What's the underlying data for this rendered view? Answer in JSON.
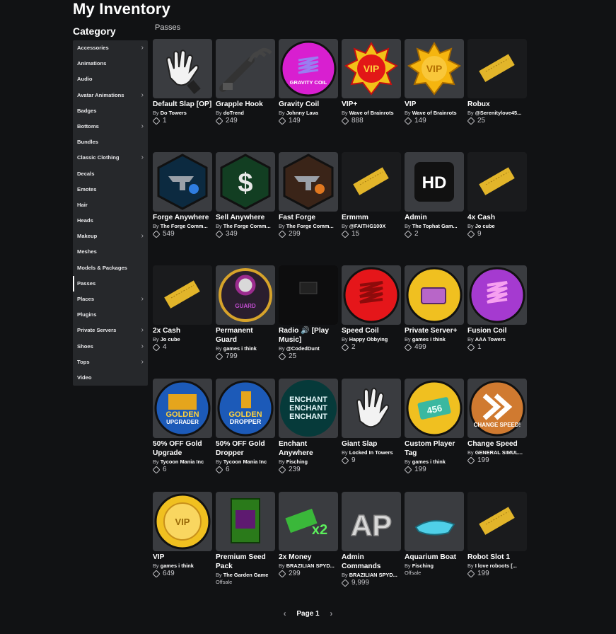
{
  "page_title": "My Inventory",
  "category_title": "Category",
  "section_label": "Passes",
  "categories": [
    {
      "label": "Accessories",
      "chevron": true
    },
    {
      "label": "Animations",
      "chevron": false
    },
    {
      "label": "Audio",
      "chevron": false
    },
    {
      "label": "Avatar Animations",
      "chevron": true
    },
    {
      "label": "Badges",
      "chevron": false
    },
    {
      "label": "Bottoms",
      "chevron": true
    },
    {
      "label": "Bundles",
      "chevron": false
    },
    {
      "label": "Classic Clothing",
      "chevron": true
    },
    {
      "label": "Decals",
      "chevron": false
    },
    {
      "label": "Emotes",
      "chevron": false
    },
    {
      "label": "Hair",
      "chevron": false
    },
    {
      "label": "Heads",
      "chevron": false
    },
    {
      "label": "Makeup",
      "chevron": true
    },
    {
      "label": "Meshes",
      "chevron": false
    },
    {
      "label": "Models & Packages",
      "chevron": false
    },
    {
      "label": "Passes",
      "chevron": false,
      "active": true
    },
    {
      "label": "Places",
      "chevron": true
    },
    {
      "label": "Plugins",
      "chevron": false
    },
    {
      "label": "Private Servers",
      "chevron": true
    },
    {
      "label": "Shoes",
      "chevron": true
    },
    {
      "label": "Tops",
      "chevron": true
    },
    {
      "label": "Video",
      "chevron": false
    }
  ],
  "by_prefix": "By",
  "items": [
    {
      "name": "Default Slap [OP]",
      "creator": "Do Towers",
      "price": "1",
      "icon": "white-glove-icon",
      "bg": "#3a3c40"
    },
    {
      "name": "Grapple Hook",
      "creator": "doTrend",
      "price": "249",
      "icon": "grapple-hook-icon",
      "bg": "#3a3c40"
    },
    {
      "name": "Gravity Coil",
      "creator": "Johnny Lava",
      "price": "149",
      "icon": "gravity-coil-icon",
      "bg": "#3a3c40"
    },
    {
      "name": "VIP+",
      "creator": "Wave of Brainrots",
      "price": "888",
      "icon": "vip-plus-badge-icon",
      "bg": "#3a3c40"
    },
    {
      "name": "VIP",
      "creator": "Wave of Brainrots",
      "price": "149",
      "icon": "vip-gold-badge-icon",
      "bg": "#3a3c40"
    },
    {
      "name": "Robux",
      "creator": "@Serenitylove45...",
      "price": "25",
      "icon": "golden-ticket-icon",
      "bg": "#1a1b1d"
    },
    {
      "name": "Forge Anywhere",
      "creator": "The Forge Comm...",
      "price": "549",
      "icon": "anvil-globe-icon",
      "bg": "#3a3c40"
    },
    {
      "name": "Sell Anywhere",
      "creator": "The Forge Comm...",
      "price": "349",
      "icon": "dollar-hexagon-icon",
      "bg": "#3a3c40"
    },
    {
      "name": "Fast Forge",
      "creator": "The Forge Comm...",
      "price": "299",
      "icon": "anvil-clock-icon",
      "bg": "#3a3c40"
    },
    {
      "name": "Ermmm",
      "creator": "@FAITHG100X",
      "price": "15",
      "icon": "golden-ticket-icon",
      "bg": "#1a1b1d"
    },
    {
      "name": "Admin",
      "creator": "The Tophat Gam...",
      "price": "2",
      "icon": "hd-logo-icon",
      "bg": "#3a3c40"
    },
    {
      "name": "4x Cash",
      "creator": "Jo cube",
      "price": "9",
      "icon": "golden-ticket-icon",
      "bg": "#1a1b1d"
    },
    {
      "name": "2x Cash",
      "creator": "Jo cube",
      "price": "4",
      "icon": "golden-ticket-icon",
      "bg": "#1a1b1d"
    },
    {
      "name": "Permanent Guard",
      "creator": "games i think",
      "price": "799",
      "icon": "guard-badge-icon",
      "bg": "#3a3c40"
    },
    {
      "name": "Radio 🔊 [Play Music]",
      "creator": "@CodedDunt",
      "price": "25",
      "icon": "radio-icon",
      "bg": "#3a3c40"
    },
    {
      "name": "Speed Coil",
      "creator": "Happy Obbying",
      "price": "2",
      "icon": "speed-coil-icon",
      "bg": "#3a3c40"
    },
    {
      "name": "Private Server+",
      "creator": "games i think",
      "price": "499",
      "icon": "private-server-icon",
      "bg": "#3a3c40"
    },
    {
      "name": "Fusion Coil",
      "creator": "AAA Towers",
      "price": "1",
      "icon": "fusion-coil-icon",
      "bg": "#3a3c40"
    },
    {
      "name": "50% OFF Gold Upgrade",
      "creator": "Tycoon Mania Inc",
      "price": "6",
      "icon": "golden-upgrader-icon",
      "bg": "#3a3c40"
    },
    {
      "name": "50% OFF Gold Dropper",
      "creator": "Tycoon Mania Inc",
      "price": "6",
      "icon": "golden-dropper-icon",
      "bg": "#3a3c40"
    },
    {
      "name": "Enchant Anywhere",
      "creator": "Fisching",
      "price": "239",
      "icon": "enchant-text-icon",
      "bg": "#3a3c40"
    },
    {
      "name": "Giant Slap",
      "creator": "Locked In Towers",
      "price": "9",
      "icon": "giant-glove-icon",
      "bg": "#3a3c40"
    },
    {
      "name": "Custom Player Tag",
      "creator": "games i think",
      "price": "199",
      "icon": "player-tag-icon",
      "bg": "#3a3c40"
    },
    {
      "name": "Change Speed",
      "creator": "GENERAL SIMUL...",
      "price": "199",
      "icon": "change-speed-icon",
      "bg": "#3a3c40"
    },
    {
      "name": "VIP",
      "creator": "games i think",
      "price": "649",
      "icon": "vip-lion-coin-icon",
      "bg": "#3a3c40"
    },
    {
      "name": "Premium Seed Pack",
      "creator": "The Garden Game",
      "price": "",
      "offsale": "Offsale",
      "icon": "seed-pack-icon",
      "bg": "#3a3c40"
    },
    {
      "name": "2x Money",
      "creator": "BRAZILIAN SPYD...",
      "price": "299",
      "icon": "money-x2-icon",
      "bg": "#3a3c40"
    },
    {
      "name": "Admin Commands",
      "creator": "BRAZILIAN SPYD...",
      "price": "9,999",
      "icon": "ap-letters-icon",
      "bg": "#3a3c40"
    },
    {
      "name": "Aquarium Boat",
      "creator": "Fisching",
      "price": "",
      "offsale": "Offsale",
      "icon": "boat-icon",
      "bg": "#3a3c40"
    },
    {
      "name": "Robot Slot 1",
      "creator": "I love roboots [...",
      "price": "199",
      "icon": "golden-ticket-icon",
      "bg": "#1a1b1d"
    }
  ],
  "pager": {
    "label": "Page 1"
  }
}
